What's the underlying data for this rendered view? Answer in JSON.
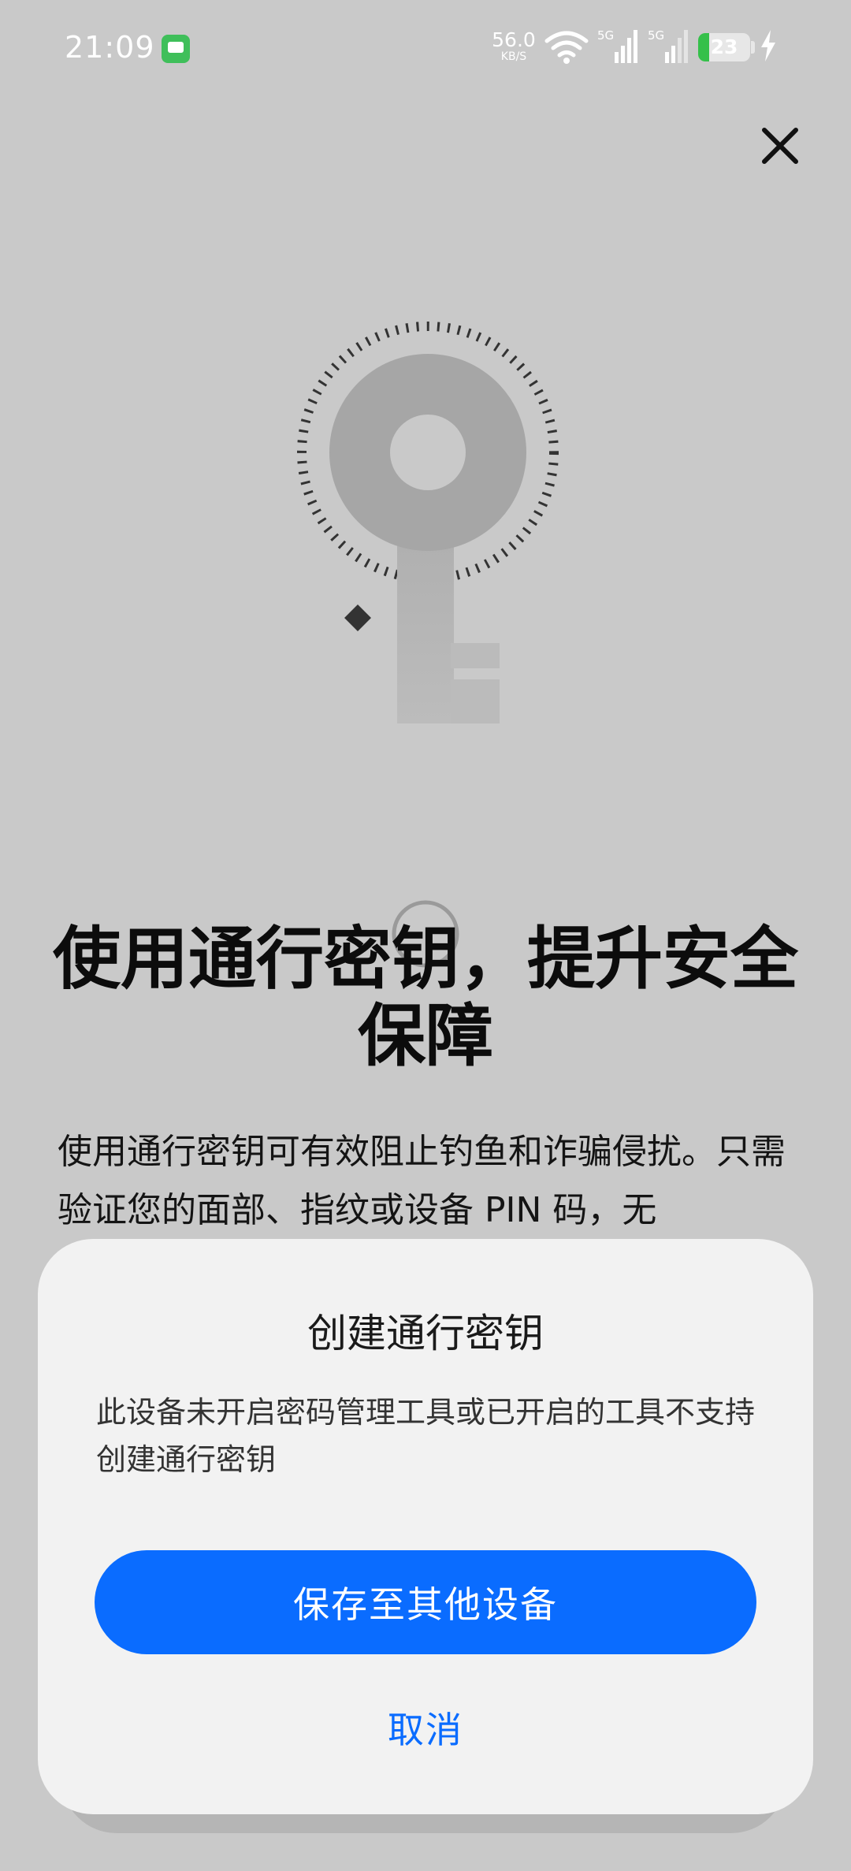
{
  "status_bar": {
    "time": "21:09",
    "speed_value": "56.0",
    "speed_unit": "KB/S",
    "network_label_1": "5G",
    "network_label_2": "5G",
    "battery_level": "23",
    "notification_icon": "message-icon"
  },
  "page": {
    "headline": "使用通行密钥，提升安全保障",
    "description": "使用通行密钥可有效阻止钓鱼和诈骗侵扰。只需验证您的面部、指纹或设备 PIN 码，无"
  },
  "sheet": {
    "title": "创建通行密钥",
    "message": "此设备未开启密码管理工具或已开启的工具不支持创建通行密钥",
    "primary_label": "保存至其他设备",
    "cancel_label": "取消"
  },
  "colors": {
    "accent": "#0a6cff",
    "background": "#c9c9c9",
    "sheet": "#f2f2f2",
    "battery": "#35c04a"
  }
}
